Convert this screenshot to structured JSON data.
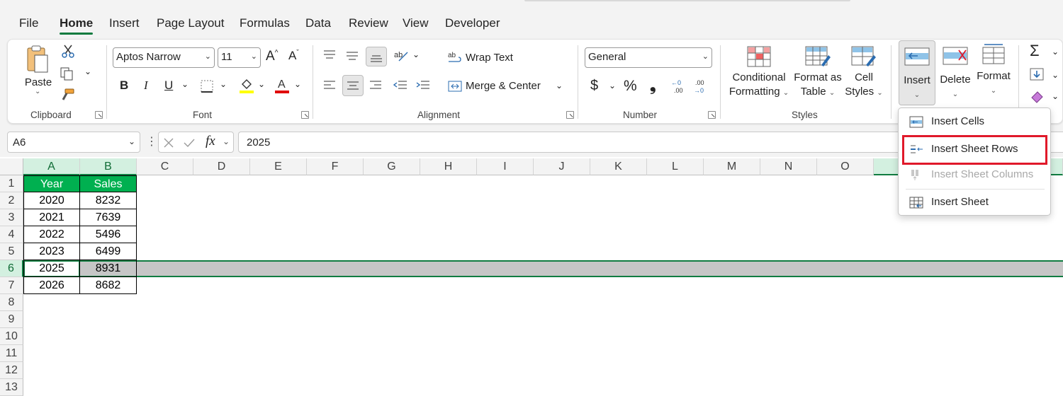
{
  "tabs": [
    "File",
    "Home",
    "Insert",
    "Page Layout",
    "Formulas",
    "Data",
    "Review",
    "View",
    "Developer"
  ],
  "active_tab": "Home",
  "ribbon": {
    "clipboard": {
      "paste_label": "Paste",
      "group_label": "Clipboard"
    },
    "font": {
      "font_name": "Aptos Narrow",
      "font_size": "11",
      "bold": "B",
      "italic": "I",
      "underline": "U",
      "group_label": "Font"
    },
    "alignment": {
      "wrap_text": "Wrap Text",
      "merge_center": "Merge & Center",
      "group_label": "Alignment"
    },
    "number": {
      "format": "General",
      "currency": "$",
      "percent": "%",
      "comma": "❟",
      "group_label": "Number"
    },
    "styles": {
      "conditional_1": "Conditional",
      "conditional_2": "Formatting",
      "format_table_1": "Format as",
      "format_table_2": "Table",
      "cell_styles_1": "Cell",
      "cell_styles_2": "Styles",
      "group_label": "Styles"
    },
    "cells": {
      "insert": "Insert",
      "delete": "Delete",
      "format": "Format"
    },
    "editing": {
      "autosum": "Σ"
    }
  },
  "formula_bar": {
    "name_box": "A6",
    "fx": "fx",
    "formula": "2025"
  },
  "sheet": {
    "columns": [
      "A",
      "B",
      "C",
      "D",
      "E",
      "F",
      "G",
      "H",
      "I",
      "J",
      "K",
      "L",
      "M",
      "N",
      "O"
    ],
    "rows": [
      "1",
      "2",
      "3",
      "4",
      "5",
      "6",
      "7",
      "8",
      "9",
      "10",
      "11",
      "12",
      "13"
    ],
    "selected_row": "6",
    "table": {
      "headers": [
        "Year",
        "Sales"
      ],
      "data": [
        [
          "2020",
          "8232"
        ],
        [
          "2021",
          "7639"
        ],
        [
          "2022",
          "5496"
        ],
        [
          "2023",
          "6499"
        ],
        [
          "2025",
          "8931"
        ],
        [
          "2026",
          "8682"
        ]
      ]
    }
  },
  "insert_menu": {
    "items": [
      {
        "label": "Insert Cells",
        "enabled": true,
        "icon": "insert-cells-icon"
      },
      {
        "label": "Insert Sheet Rows",
        "enabled": true,
        "highlighted": true,
        "icon": "insert-rows-icon"
      },
      {
        "label": "Insert Sheet Columns",
        "enabled": false,
        "icon": "insert-columns-icon"
      },
      {
        "label": "Insert Sheet",
        "enabled": true,
        "icon": "insert-sheet-icon"
      }
    ]
  },
  "colors": {
    "accent": "#107c41",
    "header_fill": "#00b050",
    "highlight_box": "#e0192a",
    "selected_row_fill": "#c6c6c6"
  }
}
